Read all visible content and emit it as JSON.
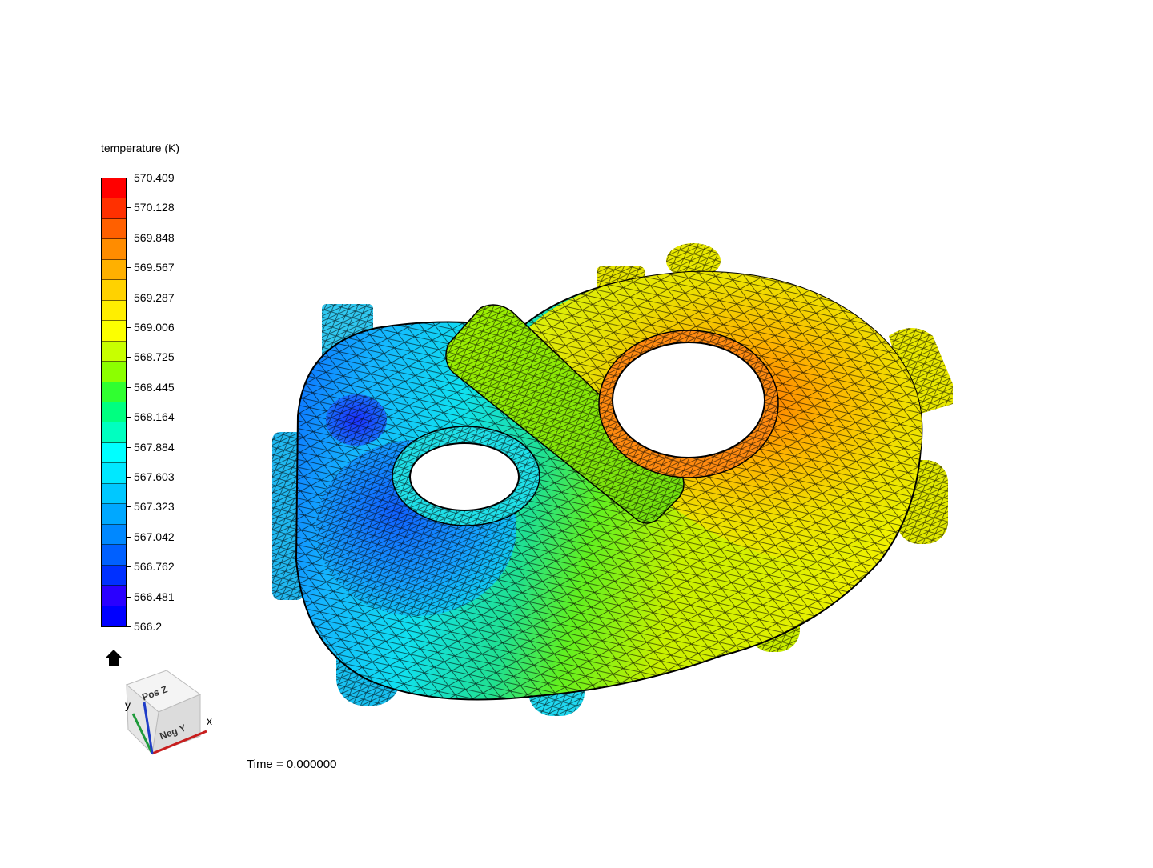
{
  "legend": {
    "title": "temperature (K)",
    "ticks": [
      "570.409",
      "570.128",
      "569.848",
      "569.567",
      "569.287",
      "569.006",
      "568.725",
      "568.445",
      "568.164",
      "567.884",
      "567.603",
      "567.323",
      "567.042",
      "566.762",
      "566.481",
      "566.2"
    ],
    "bands": [
      "#ff0000",
      "#ff3000",
      "#ff6000",
      "#ff8c00",
      "#ffb000",
      "#ffd200",
      "#ffee00",
      "#fcff00",
      "#c8ff00",
      "#8cff00",
      "#30ff30",
      "#00ff80",
      "#00ffc0",
      "#00ffff",
      "#00e8ff",
      "#00c8ff",
      "#00a8ff",
      "#0088ff",
      "#0060ff",
      "#0030ff",
      "#2a00ff",
      "#0000ff"
    ],
    "home_icon": "home-icon"
  },
  "orientation": {
    "face_top": "Pos Z",
    "face_front": "Neg Y",
    "axis_x": "x",
    "axis_y": "y",
    "axis_colors": {
      "x": "#c81e1e",
      "y": "#1e9a3a",
      "z": "#1e3cc8"
    }
  },
  "time_text": "Time = 0.000000",
  "model": {
    "field": "temperature",
    "min": 566.2,
    "max": 570.409,
    "mesh_edge_color": "#000000"
  }
}
